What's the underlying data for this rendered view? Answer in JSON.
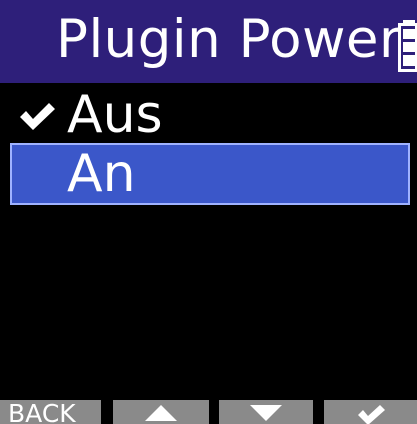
{
  "header": {
    "title": "Plugin Power",
    "battery_icon": "battery-icon"
  },
  "menu": {
    "items": [
      {
        "label": "Aus",
        "checked": true,
        "selected": false
      },
      {
        "label": "An",
        "checked": false,
        "selected": true
      }
    ],
    "check_icon": "checkmark-icon"
  },
  "softkeys": {
    "back_label": "BACK",
    "up_icon": "triangle-up-icon",
    "down_icon": "triangle-down-icon",
    "enter_icon": "checkmark-icon"
  },
  "colors": {
    "header_bg": "#2e1f7a",
    "selection_bg": "#3b57c9",
    "softkey_bg": "#8a8a8a",
    "text": "#ffffff"
  }
}
